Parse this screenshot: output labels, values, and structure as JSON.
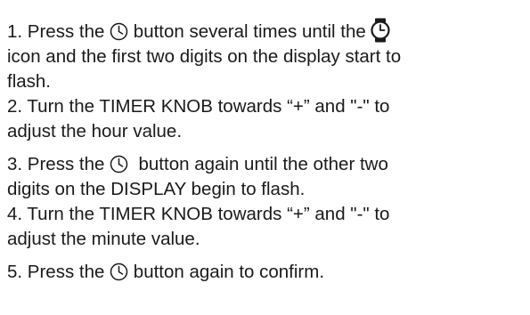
{
  "steps": [
    {
      "id": 1,
      "line1_a": "1. Press the",
      "line1_b": "button several times until the",
      "line2": "icon and the first two digits on the display start to",
      "line3": "flash."
    },
    {
      "id": 2,
      "line1": "2. Turn the TIMER KNOB towards “+” and \"-\" to",
      "line2": "adjust the hour value."
    },
    {
      "id": 3,
      "line1_a": "3. Press the",
      "line1_b": "button again until the other two",
      "line2": "digits on the DISPLAY begin to flash."
    },
    {
      "id": 4,
      "line1": "4. Turn the TIMER KNOB towards “+” and \"-\" to",
      "line2": "adjust the minute value."
    },
    {
      "id": 5,
      "line1_a": "5. Press the",
      "line1_b": "button again to confirm."
    }
  ],
  "icons": {
    "clock_button": "clock-icon",
    "watch_display": "watch-icon"
  },
  "colors": {
    "text": "#1a1a1a",
    "background": "#ffffff"
  }
}
